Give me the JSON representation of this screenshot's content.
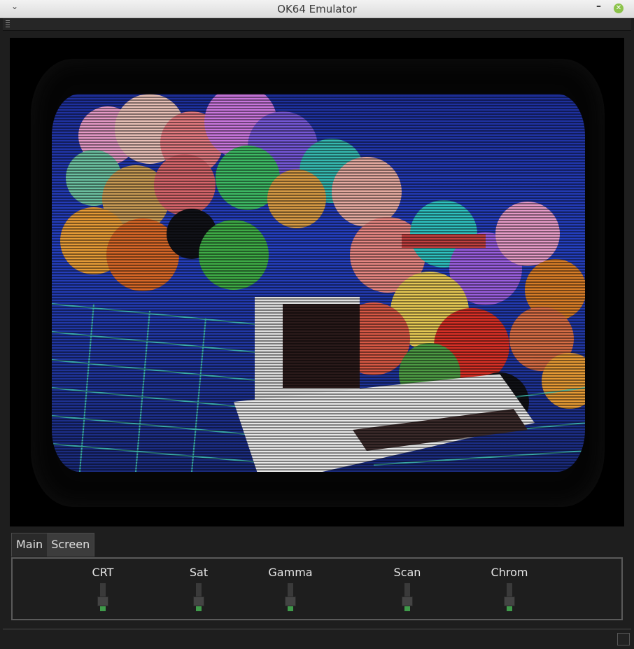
{
  "window": {
    "title": "OK64 Emulator",
    "menu_glyph": "⌄",
    "minimize_glyph": "–",
    "close_glyph": "✕"
  },
  "tabs": [
    {
      "label": "Main",
      "active": false
    },
    {
      "label": "Screen",
      "active": true
    }
  ],
  "sliders": [
    {
      "label": "CRT",
      "value": 0.35
    },
    {
      "label": "Sat",
      "value": 0.35
    },
    {
      "label": "Gamma",
      "value": 0.35
    },
    {
      "label": "Scan",
      "value": 0.35
    },
    {
      "label": "Chrom",
      "value": 0.35
    }
  ],
  "colors": {
    "accent": "#3f9a4a",
    "titlebar": "#e6e6e6",
    "background": "#1e1e1e",
    "close_button": "#8bc34a"
  }
}
